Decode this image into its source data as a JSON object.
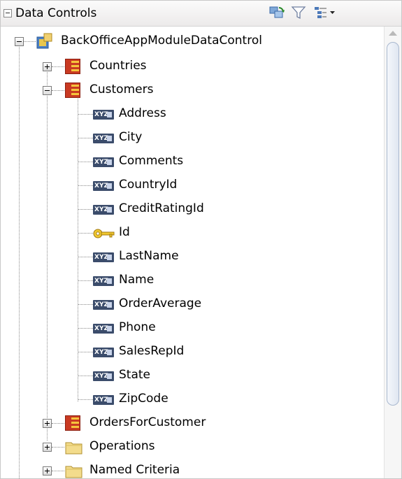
{
  "header": {
    "title": "Data Controls",
    "icons": [
      "refresh-icon",
      "filter-icon",
      "tree-options-icon"
    ]
  },
  "tree": {
    "root": {
      "label": "BackOfficeAppModuleDataControl",
      "icon": "data-control-icon",
      "expanded": true
    },
    "countries": {
      "label": "Countries",
      "icon": "collection-icon",
      "expanded": false
    },
    "customers": {
      "label": "Customers",
      "icon": "collection-icon",
      "expanded": true,
      "attributes": [
        {
          "label": "Address",
          "icon": "attribute-icon"
        },
        {
          "label": "City",
          "icon": "attribute-icon"
        },
        {
          "label": "Comments",
          "icon": "attribute-icon"
        },
        {
          "label": "CountryId",
          "icon": "attribute-icon"
        },
        {
          "label": "CreditRatingId",
          "icon": "attribute-icon"
        },
        {
          "label": "Id",
          "icon": "key-icon"
        },
        {
          "label": "LastName",
          "icon": "attribute-icon"
        },
        {
          "label": "Name",
          "icon": "attribute-icon"
        },
        {
          "label": "OrderAverage",
          "icon": "attribute-icon"
        },
        {
          "label": "Phone",
          "icon": "attribute-icon"
        },
        {
          "label": "SalesRepId",
          "icon": "attribute-icon"
        },
        {
          "label": "State",
          "icon": "attribute-icon"
        },
        {
          "label": "ZipCode",
          "icon": "attribute-icon"
        }
      ],
      "attr_badge": "XYZ"
    },
    "orders_for_customer": {
      "label": "OrdersForCustomer",
      "icon": "collection-icon",
      "expanded": false
    },
    "operations": {
      "label": "Operations",
      "icon": "folder-icon",
      "expanded": false
    },
    "named_criteria": {
      "label": "Named Criteria",
      "icon": "folder-icon",
      "expanded": false
    }
  },
  "colors": {
    "collection": "#c93a22",
    "folder": "#f2d880",
    "attribute_badge": "#3b4c6b",
    "key": "#e0b020"
  }
}
